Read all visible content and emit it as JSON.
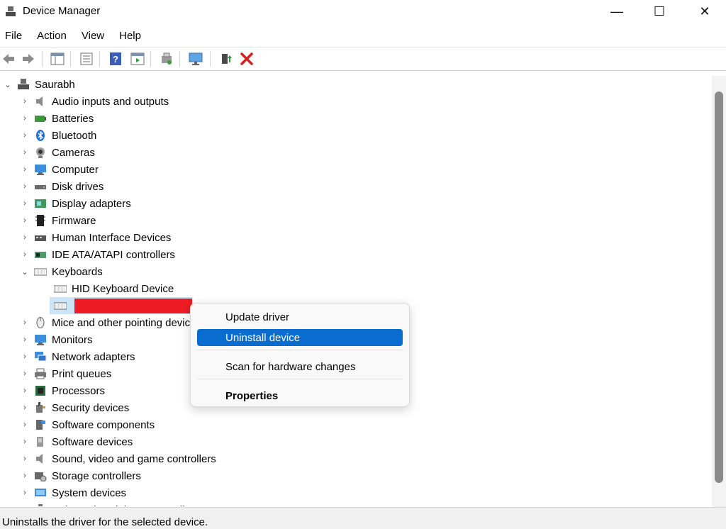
{
  "window": {
    "title": "Device Manager",
    "minimize": "—",
    "maximize": "☐",
    "close": "✕"
  },
  "menu": [
    "File",
    "Action",
    "View",
    "Help"
  ],
  "toolbar": {
    "icons": [
      "back-arrow-icon",
      "forward-arrow-icon",
      "console-tree-icon",
      "properties-icon",
      "help-icon",
      "action-pane-icon",
      "scan-hardware-icon",
      "computer-monitor-icon",
      "update-driver-icon",
      "uninstall-device-icon"
    ]
  },
  "tree": {
    "root": "Saurabh",
    "items": [
      {
        "label": "Audio inputs and outputs",
        "icon": "speaker-icon"
      },
      {
        "label": "Batteries",
        "icon": "battery-icon"
      },
      {
        "label": "Bluetooth",
        "icon": "bluetooth-icon"
      },
      {
        "label": "Cameras",
        "icon": "camera-icon"
      },
      {
        "label": "Computer",
        "icon": "computer-icon"
      },
      {
        "label": "Disk drives",
        "icon": "disk-drive-icon"
      },
      {
        "label": "Display adapters",
        "icon": "display-adapter-icon"
      },
      {
        "label": "Firmware",
        "icon": "firmware-icon"
      },
      {
        "label": "Human Interface Devices",
        "icon": "hid-icon"
      },
      {
        "label": "IDE ATA/ATAPI controllers",
        "icon": "ide-controller-icon"
      },
      {
        "label": "Keyboards",
        "icon": "keyboard-icon",
        "expanded": true
      },
      {
        "label": "Mice and other pointing devices",
        "icon": "mouse-icon"
      },
      {
        "label": "Monitors",
        "icon": "monitor-icon"
      },
      {
        "label": "Network adapters",
        "icon": "network-adapter-icon"
      },
      {
        "label": "Print queues",
        "icon": "printer-icon"
      },
      {
        "label": "Processors",
        "icon": "processor-icon"
      },
      {
        "label": "Security devices",
        "icon": "security-device-icon"
      },
      {
        "label": "Software components",
        "icon": "software-component-icon"
      },
      {
        "label": "Software devices",
        "icon": "software-device-icon"
      },
      {
        "label": "Sound, video and game controllers",
        "icon": "sound-icon"
      },
      {
        "label": "Storage controllers",
        "icon": "storage-controller-icon"
      },
      {
        "label": "System devices",
        "icon": "system-device-icon"
      },
      {
        "label": "Universal Serial Bus controllers",
        "icon": "usb-icon"
      }
    ],
    "keyboard_children": [
      "HID Keyboard Device",
      ""
    ]
  },
  "context_menu": {
    "update": "Update driver",
    "uninstall": "Uninstall device",
    "scan": "Scan for hardware changes",
    "properties": "Properties"
  },
  "status": {
    "text": "Uninstalls the driver for the selected device."
  },
  "colors": {
    "highlight": "#0a6ccf",
    "redaction": "#ed1c24"
  }
}
